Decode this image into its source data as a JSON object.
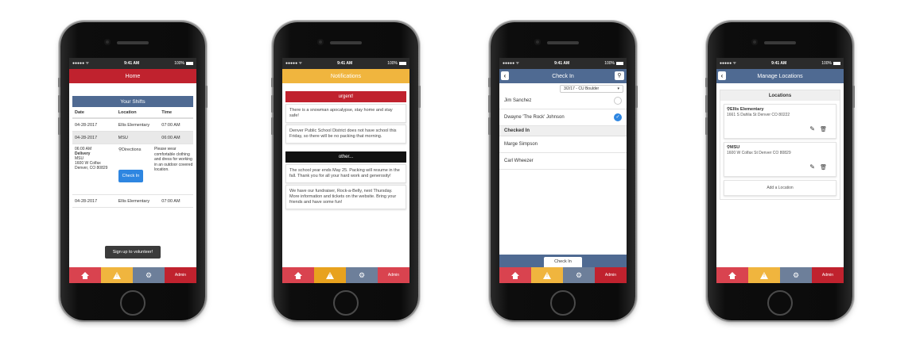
{
  "status": {
    "signal": "●●●●● ᯤ",
    "time": "9:41 AM",
    "battery": "100%"
  },
  "tabs": {
    "admin": "Admin"
  },
  "colors": {
    "home": "#c0222e",
    "notifications": "#f0b53e",
    "nav": "#4f6a92"
  },
  "home": {
    "title": "Home",
    "shifts_title": "Your Shifts",
    "columns": [
      "Date",
      "Location",
      "Time"
    ],
    "rows": [
      [
        "04-28-2017",
        "Ellis Elementary",
        "07:00 AM"
      ],
      [
        "04-28-2017",
        "MSU",
        "06:00 AM"
      ],
      [
        "04-28-2017",
        "Ellis Elementary",
        "07:00 AM"
      ]
    ],
    "detail": {
      "time": "06:00 AM",
      "type": "Delivery",
      "place": "MSU",
      "address": "1600 W Colfax Denver, CO 80829",
      "directions": "Directions",
      "checkin": "Check In",
      "note": "Please wear comfortable clothing and dress for working in an outdoor covered location."
    },
    "volunteer": "Sign up to volunteer!"
  },
  "notifications": {
    "title": "Notifications",
    "urgent_label": "urgent!",
    "urgent": [
      "There is a snowman apocalypse, stay home and stay safe!",
      "Denver Public School District does not have school this Friday, so there will be no packing that morning."
    ],
    "other_label": "other...",
    "other": [
      "The school year ends May 25. Packing will resume in the fall. Thank you for all your hard work and generosity!",
      "We have our fundraiser, Rock-a-Belly, next Thursday. More information and tickets on the website. Bring your friends and have some fun!"
    ]
  },
  "checkin": {
    "title": "Check In",
    "dropdown": "3/2/17 - CU Boulder",
    "people": [
      "Jim Sanchez",
      "Dwayne 'The Rock' Johnson"
    ],
    "checked_label": "Checked In",
    "checked": [
      "Marge Simpson",
      "Carl Wheezer"
    ],
    "button": "Check In"
  },
  "locations": {
    "title": "Manage Locations",
    "header": "Locations",
    "items": [
      {
        "name": "Ellis Elementary",
        "address": "1661 S Dahlia St Denver CO 80222"
      },
      {
        "name": "MSU",
        "address": "1600 W Colfax St Denver CO 80829"
      }
    ],
    "add": "Add a Location"
  }
}
